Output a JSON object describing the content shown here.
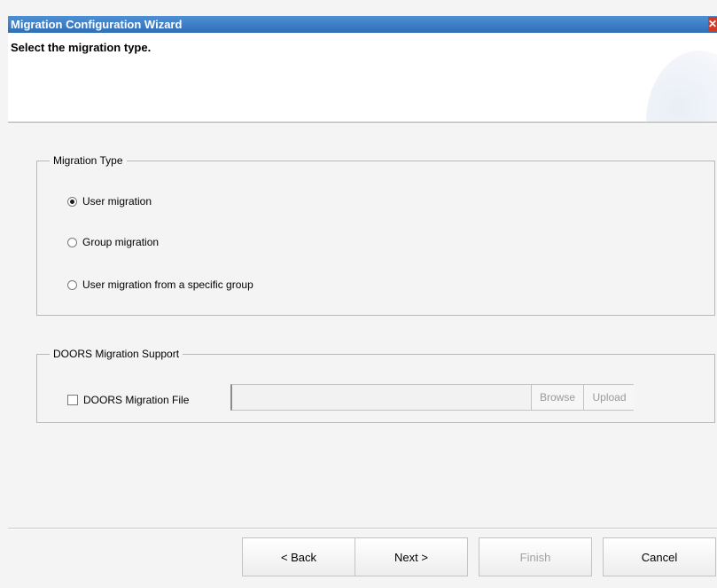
{
  "window": {
    "title": "Migration Configuration Wizard",
    "close_glyph": "✕"
  },
  "header": {
    "title": "Select the migration type."
  },
  "migration_type": {
    "legend": "Migration Type",
    "selected": "user",
    "options": [
      {
        "id": "user",
        "label": "User migration",
        "checked": true
      },
      {
        "id": "group",
        "label": "Group migration",
        "checked": false
      },
      {
        "id": "user-from-group",
        "label": "User migration from a specific group",
        "checked": false
      }
    ]
  },
  "doors": {
    "legend": "DOORS Migration Support",
    "checkbox_label": "DOORS Migration File",
    "checked": false,
    "file_value": "",
    "browse_label": "Browse",
    "upload_label": "Upload"
  },
  "footer": {
    "back_label": "< Back",
    "next_label": "Next >",
    "finish_label": "Finish",
    "cancel_label": "Cancel"
  },
  "colors": {
    "titlebar": "#3a7cc5",
    "close": "#d23a26",
    "disabled_text": "#a3a3a3"
  }
}
